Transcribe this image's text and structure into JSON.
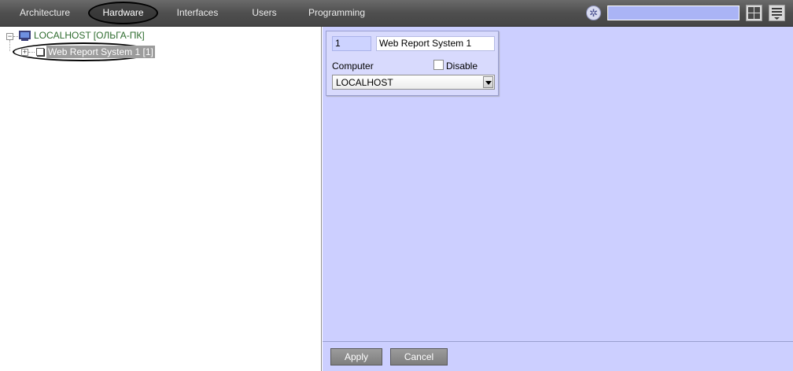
{
  "nav": {
    "tabs": [
      {
        "label": "Architecture"
      },
      {
        "label": "Hardware",
        "active": true
      },
      {
        "label": "Interfaces"
      },
      {
        "label": "Users"
      },
      {
        "label": "Programming"
      }
    ],
    "search_value": "",
    "gear_glyph": "✲"
  },
  "tree": {
    "root": {
      "label": "LOCALHOST [ОЛЬГА-ПК]",
      "icon": "computer-icon"
    },
    "child": {
      "label": "Web Report System 1 [1]",
      "icon": "device-icon",
      "selected": true
    }
  },
  "settings": {
    "id_value": "1",
    "name_value": "Web Report System 1",
    "computer_label": "Computer",
    "disable_label": "Disable",
    "disable_checked": false,
    "computer_value": "LOCALHOST"
  },
  "buttons": {
    "apply": "Apply",
    "cancel": "Cancel"
  },
  "colors": {
    "panel_background": "#cccfff",
    "topbar": "#555555",
    "tree_host_text": "#2d6b2d"
  }
}
